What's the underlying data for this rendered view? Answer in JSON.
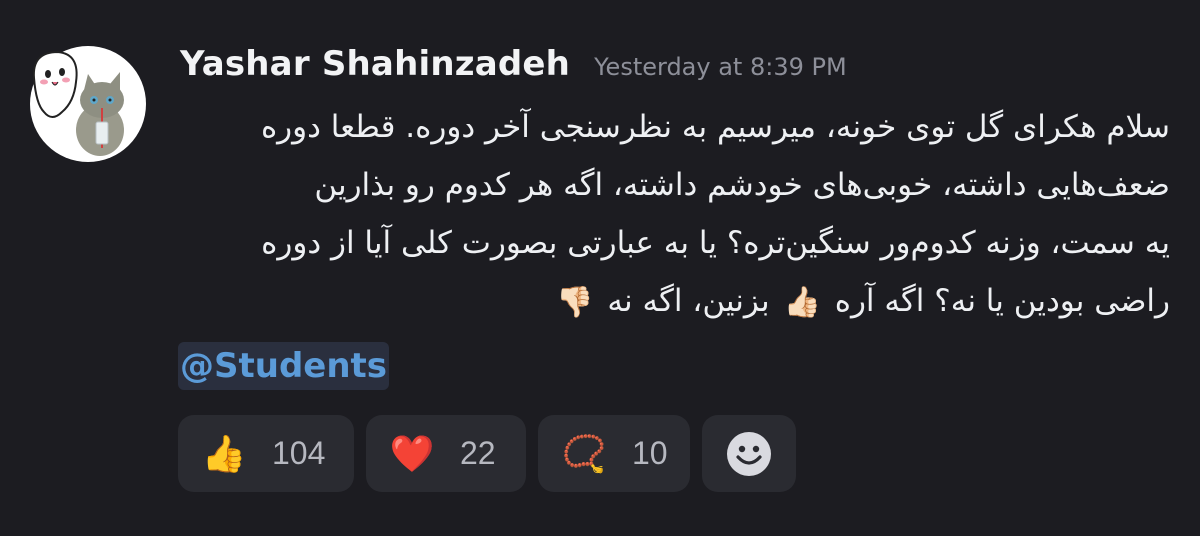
{
  "message": {
    "username": "Yashar Shahinzadeh",
    "timestamp": "Yesterday at 8:39 PM",
    "lines": [
      "سلام هکرای گل توی خونه، میرسیم به نظرسنجی آخر دوره. قطعا دوره",
      "ضعف‌هایی داشته، خوبی‌های خودشم داشته، اگه هر کدوم رو بذارین",
      "یه سمت، وزنه کدوم‌ور سنگین‌تره؟ یا به عبارتی بصورت کلی آیا از دوره"
    ],
    "last_line": {
      "part1": "راضی بودین یا نه؟ اگه آره",
      "emoji1": "👍🏻",
      "part2": "بزنین، اگه نه",
      "emoji2": "👎🏻"
    },
    "mention": "@Students"
  },
  "reactions": [
    {
      "emoji": "👍",
      "count": "104"
    },
    {
      "emoji": "❤️",
      "count": "22"
    },
    {
      "emoji": "📿",
      "count": "10"
    }
  ],
  "icons": {
    "avatar": "ghost-cat-avatar",
    "add_reaction": "smile-icon"
  }
}
